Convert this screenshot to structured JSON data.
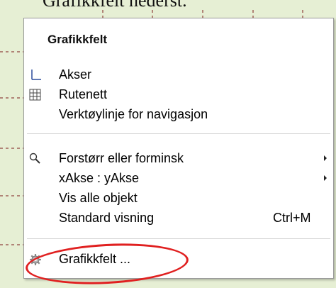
{
  "background": {
    "title_fragment": "Grafikkfelt nederst.",
    "color": "#e6efd4",
    "grid_color": "#7a1a1a"
  },
  "menu": {
    "title": "Grafikkfelt",
    "items": [
      {
        "label": "Akser",
        "icon": "axes-icon",
        "shortcut": "",
        "submenu": false
      },
      {
        "label": "Rutenett",
        "icon": "grid-icon",
        "shortcut": "",
        "submenu": false
      },
      {
        "label": "Verktøylinje for navigasjon",
        "icon": "",
        "shortcut": "",
        "submenu": false
      },
      {
        "label": "Forstørr eller forminsk",
        "icon": "magnifier-icon",
        "shortcut": "",
        "submenu": true
      },
      {
        "label": "xAkse : yAkse",
        "icon": "",
        "shortcut": "",
        "submenu": true
      },
      {
        "label": "Vis alle objekt",
        "icon": "",
        "shortcut": "",
        "submenu": false
      },
      {
        "label": "Standard visning",
        "icon": "",
        "shortcut": "Ctrl+M",
        "submenu": false
      },
      {
        "label": "Grafikkfelt ...",
        "icon": "gear-icon",
        "shortcut": "",
        "submenu": false
      }
    ]
  },
  "annotation": {
    "ring_color": "#e02020"
  }
}
